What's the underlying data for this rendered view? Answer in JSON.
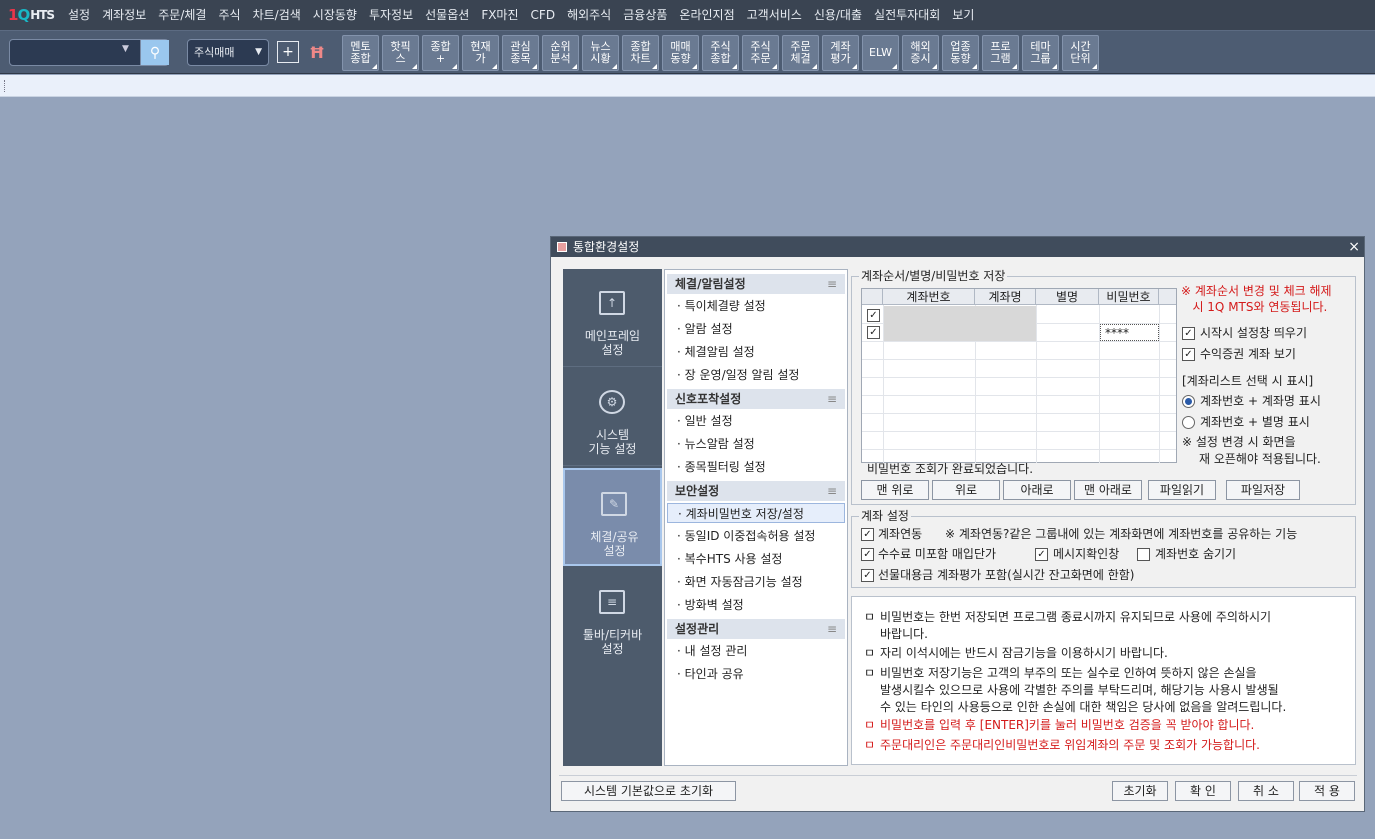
{
  "logo": {
    "part1": "1",
    "part2": "Q",
    "part3": "HTS"
  },
  "menubar": [
    "설정",
    "계좌정보",
    "주문/체결",
    "주식",
    "차트/검색",
    "시장동향",
    "투자정보",
    "선물옵션",
    "FX마진",
    "CFD",
    "해외주식",
    "금융상품",
    "온라인지점",
    "고객서비스",
    "신용/대출",
    "실전투자대회",
    "보기"
  ],
  "toolbar": {
    "search_value": "",
    "order_select": "주식매매",
    "buttons": [
      "멘토\n종합",
      "핫픽\n스",
      "종합\n+",
      "현재\n가",
      "관심\n종목",
      "순위\n분석",
      "뉴스\n시황",
      "종합\n차트",
      "매매\n동향",
      "주식\n종합",
      "주식\n주문",
      "주문\n체결",
      "계좌\n평가",
      "ELW",
      "해외\n증시",
      "업종\n동향",
      "프로\n그램",
      "테마\n그룹",
      "시간\n단위"
    ]
  },
  "dialog": {
    "title": "통합환경설정",
    "close": "×",
    "categories": [
      {
        "label": "메인프레임\n설정",
        "icon": "monitor-icon"
      },
      {
        "label": "시스템\n기능 설정",
        "icon": "gear-icon"
      },
      {
        "label": "체결/공유\n설정",
        "icon": "document-icon"
      },
      {
        "label": "툴바/티커바\n설정",
        "icon": "toolbar-icon"
      }
    ],
    "menu": {
      "sec1": "체결/알림설정",
      "items1": [
        "· 특이체결량 설정",
        "· 알람 설정",
        "· 체결알림 설정",
        "· 장 운영/일정 알림 설정"
      ],
      "sec2": "신호포착설정",
      "items2": [
        "· 일반 설정",
        "· 뉴스알람 설정",
        "· 종목필터링 설정"
      ],
      "sec3": "보안설정",
      "items3": [
        "· 계좌비밀번호 저장/설정",
        "· 동일ID 이중접속허용 설정",
        "· 복수HTS 사용 설정",
        "· 화면 자동잠금기능 설정",
        "· 방화벽 설정"
      ],
      "sec4": "설정관리",
      "items4": [
        "· 내 설정 관리",
        "· 타인과 공유"
      ]
    },
    "account": {
      "legend": "계좌순서/별명/비밀번호 저장",
      "cols": [
        "계좌번호",
        "계좌명",
        "별명",
        "비밀번호"
      ],
      "row1_pw": "",
      "row2_pw": "****",
      "status": "비밀번호 조회가 완료되었습니다.",
      "buttons": [
        "맨 위로",
        "위로",
        "아래로",
        "맨 아래로",
        "파일읽기",
        "파일저장"
      ],
      "warn": "※ 계좌순서 변경 및 체크 해제\n   시 1Q MTS와 연동됩니다.",
      "opt_popup": "시작시 설정창 띄우기",
      "opt_showsec": "수익증권 계좌 보기",
      "list_title": "[계좌리스트 선택 시 표시]",
      "radio1": "계좌번호 + 계좌명 표시",
      "radio2": "계좌번호 + 별명 표시",
      "note1": "※ 설정 변경 시 화면을",
      "note2": "재 오픈해야 적용됩니다."
    },
    "acct_settings": {
      "legend": "계좌 설정",
      "link": "계좌연동",
      "link_desc": "※ 계좌연동?같은 그룹내에 있는 계좌화면에 계좌번호를 공유하는 기능",
      "fee": "수수료 미포함 매입단가",
      "msgconfirm": "메시지확인창",
      "hideacct": "계좌번호 숨기기",
      "futures": "선물대용금 계좌평가 포함(실시간 잔고화면에 한함)"
    },
    "notes": [
      {
        "text": "비밀번호는 한번 저장되면 프로그램 종료시까지 유지되므로 사용에 주의하시기\n바랍니다.",
        "red": false
      },
      {
        "text": "자리 이석시에는 반드시 잠금기능을 이용하시기 바랍니다.",
        "red": false
      },
      {
        "text": "비밀번호 저장기능은 고객의 부주의 또는 실수로 인하여 뜻하지 않은 손실을\n발생시킬수 있으므로 사용에 각별한 주의를 부탁드리며, 해당기능 사용시 발생될\n수 있는 타인의 사용등으로 인한 손실에 대한 책임은 당사에 없음을 알려드립니다.",
        "red": false
      },
      {
        "text": "비밀번호를 입력 후 [ENTER]키를 눌러 비밀번호 검증을 꼭 받아야 합니다.",
        "red": true
      },
      {
        "text": "주문대리인은 주문대리인비밀번호로 위임계좌의 주문 및 조회가 가능합니다.",
        "red": true
      }
    ],
    "bullet": "ㅁ",
    "footer": {
      "reset_system": "시스템 기본값으로 초기화",
      "init": "초기화",
      "ok": "확 인",
      "cancel": "취 소",
      "apply": "적 용"
    }
  }
}
